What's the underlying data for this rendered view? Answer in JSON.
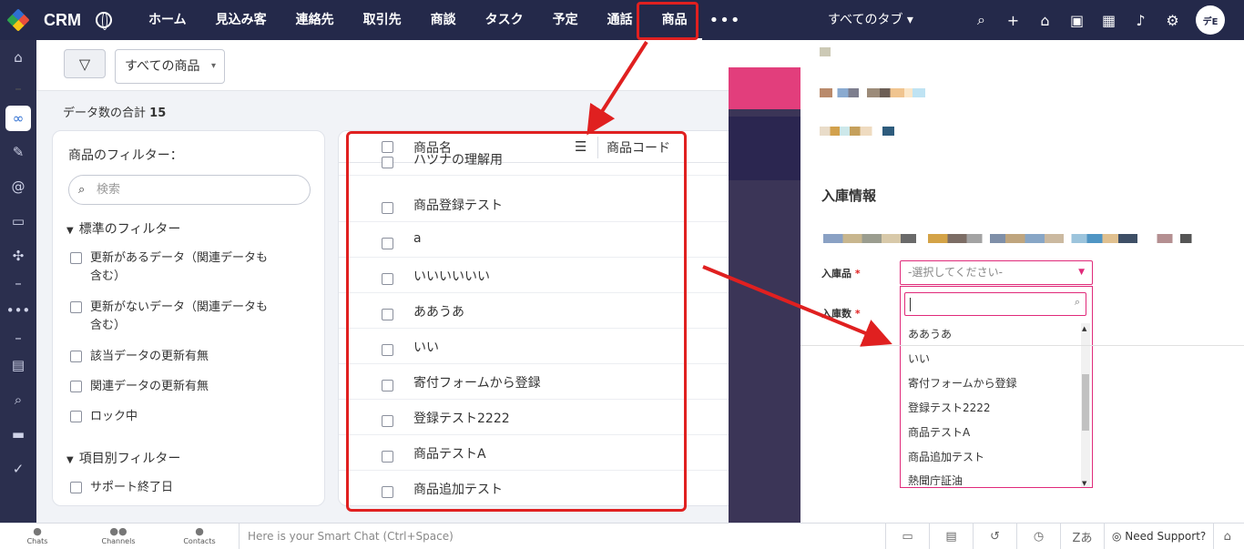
{
  "app": {
    "brand": "CRM"
  },
  "nav": {
    "items": [
      "ホーム",
      "見込み客",
      "連絡先",
      "取引先",
      "商談",
      "タスク",
      "予定",
      "通話",
      "商品"
    ],
    "more": "•••",
    "all_tabs": "すべてのタブ ▾",
    "avatar": "デE"
  },
  "toolbar": {
    "view": "すべての商品",
    "caret": "▾"
  },
  "total": {
    "label": "データ数の合計",
    "count": "15"
  },
  "filter": {
    "title": "商品のフィルター：",
    "search_placeholder": "検索",
    "group_std": "標準のフィルター",
    "std_items": [
      "更新があるデータ（関連データも",
      "含む）",
      "更新がないデータ（関連データも",
      "含む）",
      "該当データの更新有無",
      "関連データの更新有無",
      "ロック中"
    ],
    "group_field": "項目別フィルター",
    "field_items": [
      "サポート終了日"
    ]
  },
  "list": {
    "col_name": "商品名",
    "col_code": "商品コード",
    "rows": [
      "ハツナの理解用",
      "商品登録テスト",
      "a",
      "いいいいいい",
      "ああうあ",
      "いい",
      "寄付フォームから登録",
      "登録テスト2222",
      "商品テストA",
      "商品追加テスト"
    ]
  },
  "right": {
    "section": "入庫情報",
    "field1_label": "入庫品",
    "field2_label": "入庫数",
    "required_mark": "*",
    "select_placeholder": "-選択してください-",
    "options": [
      "ああうあ",
      "いい",
      "寄付フォームから登録",
      "登録テスト2222",
      "商品テストA",
      "商品追加テスト",
      "熱聞庁証油"
    ]
  },
  "bottom": {
    "chats": "Chats",
    "channels": "Channels",
    "contacts": "Contacts",
    "smart_chat": "Here is your Smart Chat (Ctrl+Space)",
    "support": "Need Support?"
  },
  "colors": {
    "topbar": "#24294a",
    "highlight": "#e02020",
    "accent_pink": "#e02a7a"
  }
}
